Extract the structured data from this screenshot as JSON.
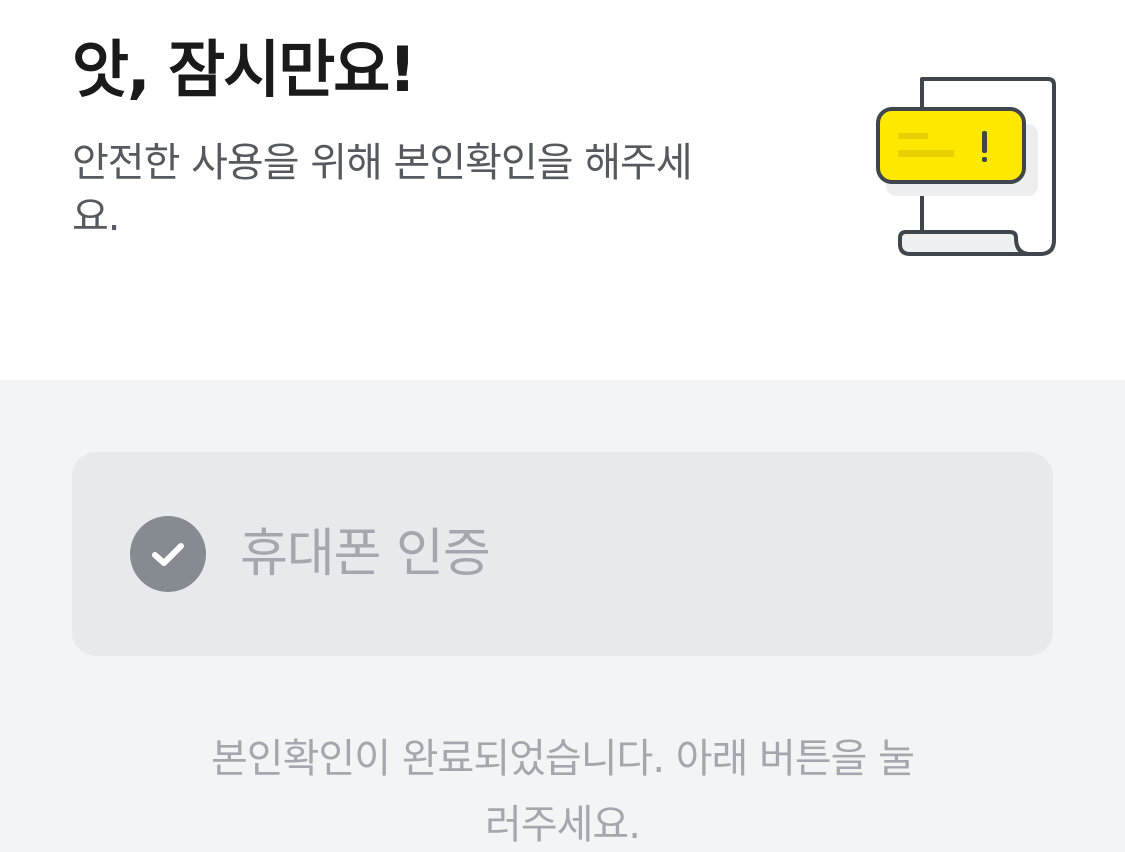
{
  "header": {
    "title": "앗, 잠시만요!",
    "subtitle": "안전한 사용을 위해 본인확인을 해주세요.",
    "illustration_icon": "document-alert-icon",
    "accent_color": "#FFE800"
  },
  "auth": {
    "method_label": "휴대폰 인증",
    "status_icon": "check-circle-icon",
    "completed": true
  },
  "notice": {
    "text": "본인확인이 완료되었습니다. 아래 버튼을 눌러주세요."
  }
}
